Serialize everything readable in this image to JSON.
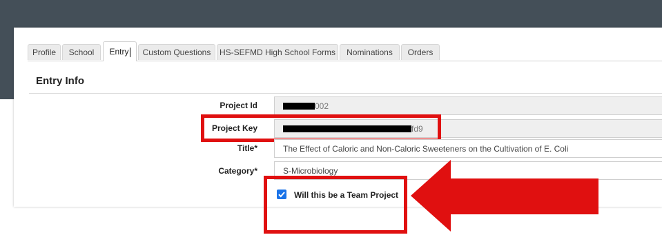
{
  "tabs": [
    {
      "label": "Profile"
    },
    {
      "label": "School"
    },
    {
      "label": "Entry"
    },
    {
      "label": "Custom Questions"
    },
    {
      "label": "HS-SEFMD High School Forms"
    },
    {
      "label": "Nominations"
    },
    {
      "label": "Orders"
    }
  ],
  "active_tab": "Entry",
  "section": {
    "title": "Entry Info"
  },
  "fields": {
    "project_id": {
      "label": "Project Id",
      "value_suffix": "002"
    },
    "project_key": {
      "label": "Project Key",
      "value_suffix": "fd9"
    },
    "title": {
      "label": "Title*",
      "value": "The Effect of Caloric and Non-Caloric Sweeteners on the Cultivation of E. Coli"
    },
    "category": {
      "label": "Category*",
      "value": "S-Microbiology"
    }
  },
  "team_project": {
    "label": "Will this be a Team Project",
    "checked": true
  },
  "colors": {
    "header": "#444f58",
    "highlight": "#e01010",
    "checkbox": "#1a73e8"
  },
  "icons": [
    "check-icon",
    "red-arrow-icon",
    "text-cursor-icon"
  ]
}
